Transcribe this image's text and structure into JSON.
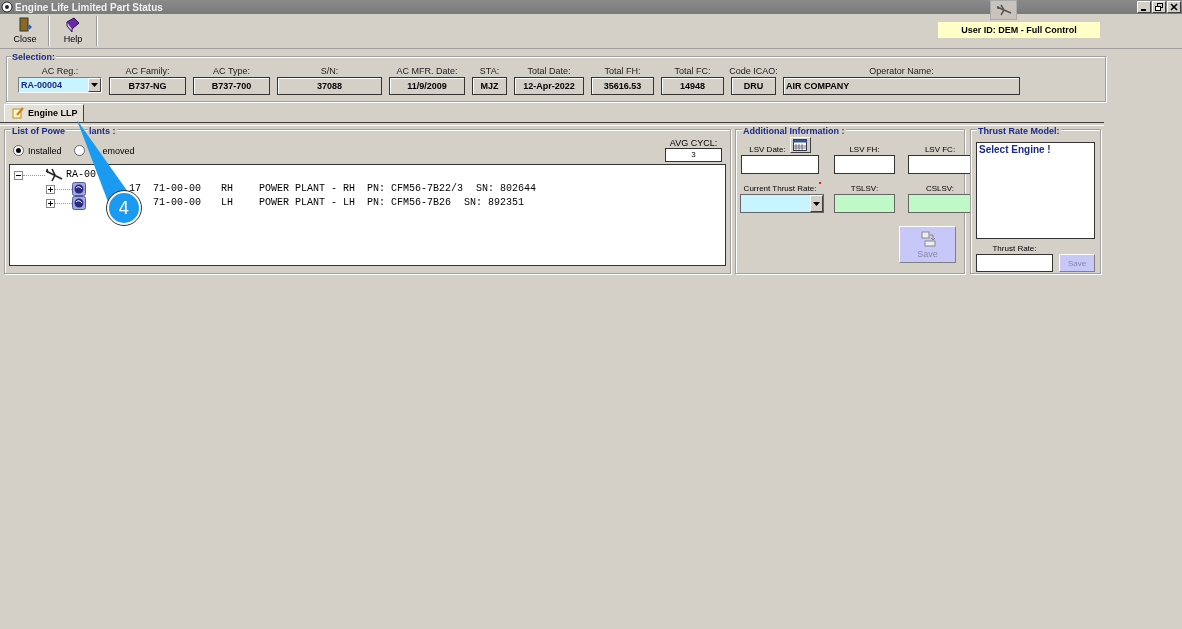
{
  "window": {
    "title": "Engine Life Limited Part Status"
  },
  "toolbar": [
    {
      "label": "Close",
      "kind": "close"
    },
    {
      "label": "Help",
      "kind": "help"
    }
  ],
  "user_badge": "User ID: DEM - Full Control",
  "selection": {
    "title": "Selection:",
    "fields": [
      {
        "label": "AC Reg.:",
        "value": "RA-00004",
        "kind": "combo"
      },
      {
        "label": "AC Family:",
        "value": "B737-NG",
        "kind": "readonly"
      },
      {
        "label": "AC Type:",
        "value": "B737-700",
        "kind": "readonly"
      },
      {
        "label": "S/N:",
        "value": "37088",
        "kind": "readonly"
      },
      {
        "label": "AC MFR. Date:",
        "value": "11/9/2009",
        "kind": "readonly"
      },
      {
        "label": "STA:",
        "value": "MJZ",
        "kind": "readonly"
      },
      {
        "label": "Total Date:",
        "value": "12-Apr-2022",
        "kind": "readonly"
      },
      {
        "label": "Total FH:",
        "value": "35616.53",
        "kind": "readonly"
      },
      {
        "label": "Total FC:",
        "value": "14948",
        "kind": "readonly"
      },
      {
        "label": "Code ICAO:",
        "value": "DRU",
        "kind": "readonly"
      },
      {
        "label": "Operator Name:",
        "value": "AIR COMPANY",
        "kind": "wide"
      }
    ]
  },
  "tabs": [
    {
      "label": "Engine LLP",
      "selected": true
    }
  ],
  "power_plants": {
    "title": "List of Powe",
    "title_rest": "lants :",
    "filters": [
      {
        "label": "Installed",
        "selected": true
      },
      {
        "label": "emoved",
        "selected": false
      }
    ],
    "avg_cycl": {
      "label": "AVG CYCL:",
      "value": "3"
    },
    "tree": {
      "root": "RA-00",
      "expanded": true,
      "children": [
        {
          "lead": "17",
          "ata": "71-00-00",
          "side": "RH",
          "description": "POWER PLANT - RH",
          "pn": "PN: CFM56-7B22/3",
          "sn": "SN: 802644",
          "expanded": false
        },
        {
          "ata": "71-00-00",
          "side": "LH",
          "description": "POWER PLANT - LH",
          "pn": "PN: CFM56-7B26",
          "sn": "SN: 892351",
          "expanded": false
        }
      ]
    }
  },
  "additional_info": {
    "title": "Additional Information :",
    "fields": [
      {
        "label": "LSV Date:",
        "kind": "date"
      },
      {
        "label": "LSV FH:",
        "kind": "text"
      },
      {
        "label": "LSV FC:",
        "kind": "text"
      },
      {
        "label": "Current Thrust Rate:",
        "kind": "combo",
        "required": true
      },
      {
        "label": "TSLSV:",
        "kind": "computed"
      },
      {
        "label": "CSLSV:",
        "kind": "computed"
      }
    ],
    "save": {
      "label": "Save",
      "disabled": true
    }
  },
  "thrust_model": {
    "title": "Thrust Rate Model:",
    "message": "Select Engine !",
    "rate_label": "Thrust Rate:",
    "save": {
      "label": "Save",
      "disabled": true
    }
  },
  "callout": {
    "label": "4"
  }
}
